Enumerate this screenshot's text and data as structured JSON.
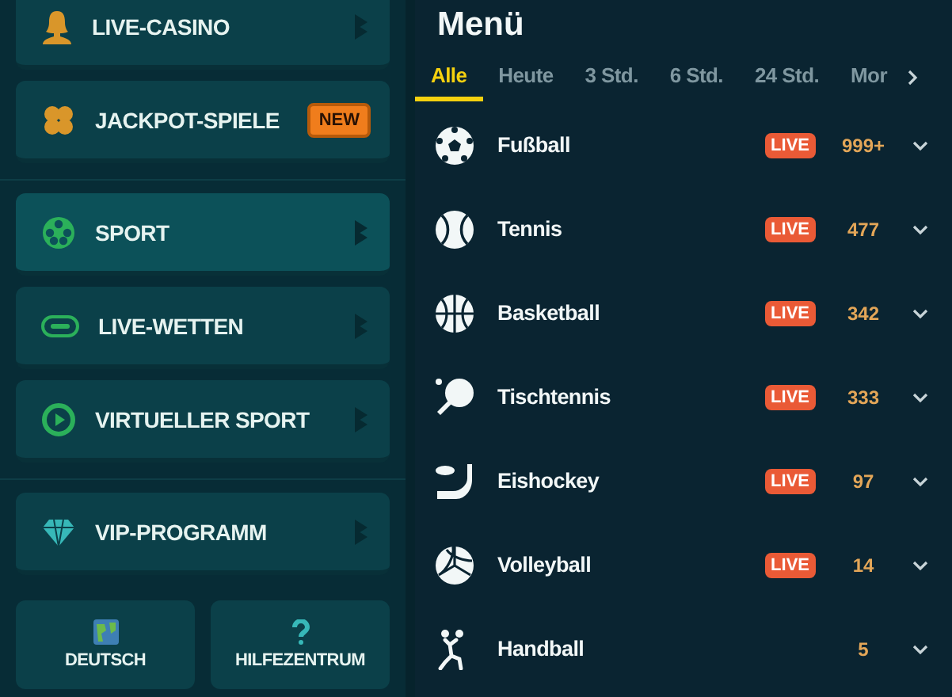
{
  "sidebar": {
    "groups": [
      {
        "items": [
          {
            "label": "LIVE-CASINO",
            "selected": false
          },
          {
            "label": "JACKPOT-SPIELE",
            "selected": false,
            "badge": "NEW"
          }
        ]
      },
      {
        "items": [
          {
            "label": "SPORT",
            "selected": true
          },
          {
            "label": "LIVE-WETTEN",
            "selected": false
          },
          {
            "label": "VIRTUELLER SPORT",
            "selected": false
          }
        ]
      },
      {
        "items": [
          {
            "label": "VIP-PROGRAMM",
            "selected": false
          }
        ]
      }
    ],
    "footer_buttons": [
      {
        "label": "DEUTSCH"
      },
      {
        "label": "HILFEZENTRUM"
      }
    ]
  },
  "menu": {
    "title": "Menü",
    "tabs": [
      {
        "label": "Alle",
        "selected": true
      },
      {
        "label": "Heute",
        "selected": false
      },
      {
        "label": "3 Std.",
        "selected": false
      },
      {
        "label": "6 Std.",
        "selected": false
      },
      {
        "label": "24 Std.",
        "selected": false
      },
      {
        "label": "Mor",
        "selected": false
      }
    ],
    "sports": [
      {
        "name": "Fußball",
        "badge": "LIVE",
        "count": "999+"
      },
      {
        "name": "Tennis",
        "badge": "LIVE",
        "count": "477"
      },
      {
        "name": "Basketball",
        "badge": "LIVE",
        "count": "342"
      },
      {
        "name": "Tischtennis",
        "badge": "LIVE",
        "count": "333"
      },
      {
        "name": "Eishockey",
        "badge": "LIVE",
        "count": "97"
      },
      {
        "name": "Volleyball",
        "badge": "LIVE",
        "count": "14"
      },
      {
        "name": "Handball",
        "count": "5"
      }
    ]
  }
}
